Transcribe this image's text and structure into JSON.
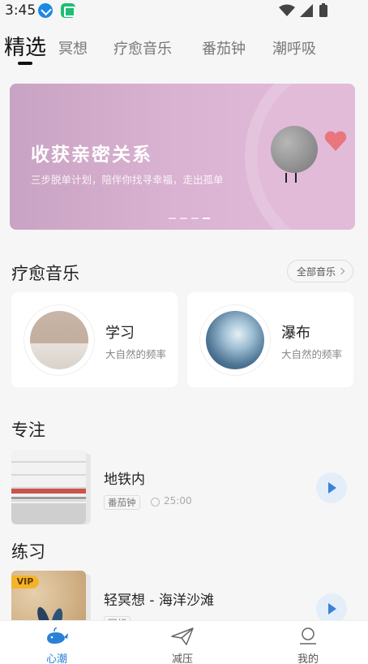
{
  "status_bar": {
    "time": "3:45"
  },
  "top_tabs": [
    {
      "label": "精选",
      "active": true
    },
    {
      "label": "冥想",
      "active": false
    },
    {
      "label": "疗愈音乐",
      "active": false
    },
    {
      "label": "番茄钟",
      "active": false
    },
    {
      "label": "潮呼吸",
      "active": false
    }
  ],
  "banner": {
    "title": "收获亲密关系",
    "subtitle": "三步脱单计划，陪伴你找寻幸福，走出孤单",
    "carousel_index": 4,
    "carousel_count": 4
  },
  "healing_music": {
    "title": "疗愈音乐",
    "all_label": "全部音乐",
    "items": [
      {
        "name": "学习",
        "desc": "大自然的频率"
      },
      {
        "name": "瀑布",
        "desc": "大自然的频率"
      }
    ]
  },
  "focus": {
    "title": "专注",
    "items": [
      {
        "title": "地铁内",
        "tag": "番茄钟",
        "duration": "25:00"
      }
    ]
  },
  "practice": {
    "title": "练习",
    "items": [
      {
        "title": "轻冥想 - 海洋沙滩",
        "tag": "冥想",
        "badge": "VIP"
      }
    ]
  },
  "bottom_nav": [
    {
      "label": "心潮",
      "icon": "whale-icon",
      "active": true
    },
    {
      "label": "减压",
      "icon": "paper-plane-icon",
      "active": false
    },
    {
      "label": "我的",
      "icon": "profile-icon",
      "active": false
    }
  ],
  "colors": {
    "accent": "#2a80d6",
    "banner_bg": "#d9b1d1",
    "vip": "#f5b32a"
  }
}
